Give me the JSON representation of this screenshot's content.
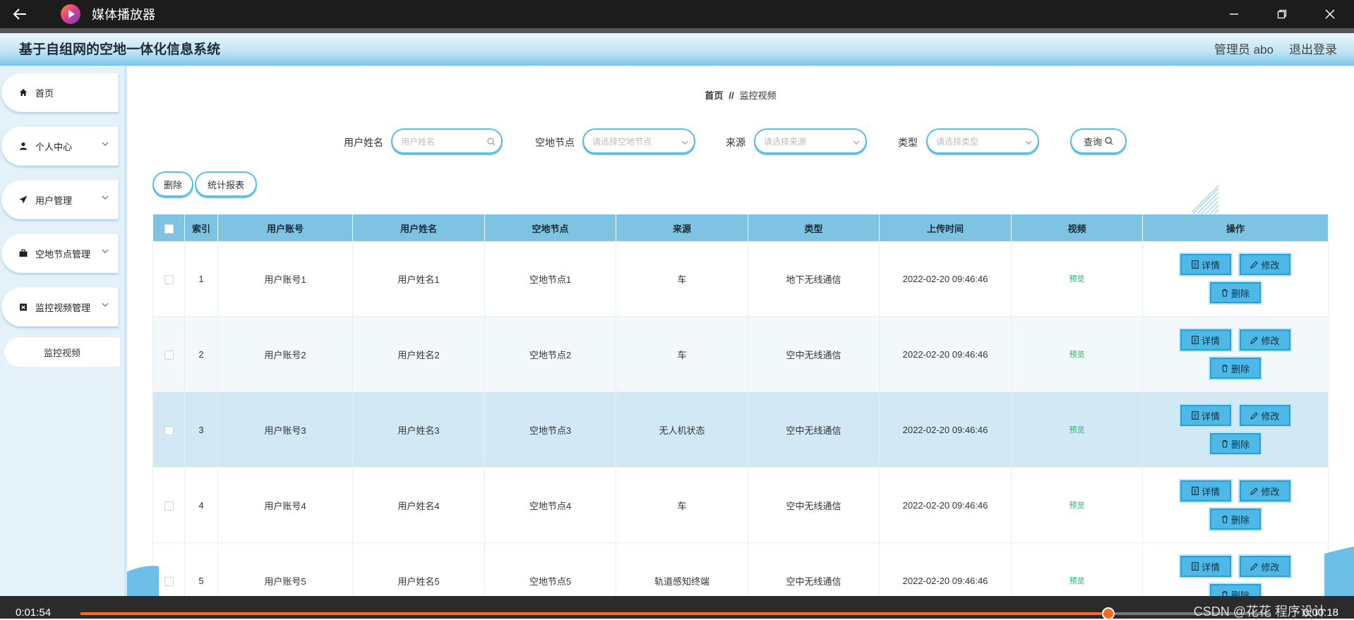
{
  "player": {
    "app_title": "媒体播放器",
    "time_elapsed": "0:01:54",
    "time_remaining": "0:00:18",
    "progress_fraction": 0.8635,
    "watermark": "CSDN @花花 程序设计"
  },
  "header": {
    "system_title": "基于自组网的空地一体化信息系统",
    "admin_label": "管理员 abo",
    "logout_label": "退出登录"
  },
  "sidebar": {
    "items": [
      {
        "label": "首页",
        "icon": "home-icon"
      },
      {
        "label": "个人中心",
        "icon": "user-icon"
      },
      {
        "label": "用户管理",
        "icon": "send-icon"
      },
      {
        "label": "空地节点管理",
        "icon": "briefcase-icon"
      },
      {
        "label": "监控视频管理",
        "icon": "clipboard-icon"
      }
    ],
    "sub_item": "监控视频"
  },
  "breadcrumb": {
    "home": "首页",
    "separator": "//",
    "current": "监控视频"
  },
  "search": {
    "username_label": "用户姓名",
    "username_placeholder": "用户姓名",
    "node_label": "空地节点",
    "node_placeholder": "请选择空地节点",
    "source_label": "来源",
    "source_placeholder": "请选择来源",
    "type_label": "类型",
    "type_placeholder": "请选择类型",
    "query_label": "查询"
  },
  "actions": {
    "delete_label": "删除",
    "report_label": "统计报表"
  },
  "table": {
    "columns": [
      "索引",
      "用户账号",
      "用户姓名",
      "空地节点",
      "来源",
      "类型",
      "上传时间",
      "视频",
      "操作"
    ],
    "detail_label": "详情",
    "edit_label": "修改",
    "delete_label": "删除",
    "preview_label": "预览",
    "rows": [
      {
        "index": "1",
        "account": "用户账号1",
        "name": "用户姓名1",
        "node": "空地节点1",
        "source": "车",
        "type": "地下无线通信",
        "time": "2022-02-20 09:46:46"
      },
      {
        "index": "2",
        "account": "用户账号2",
        "name": "用户姓名2",
        "node": "空地节点2",
        "source": "车",
        "type": "空中无线通信",
        "time": "2022-02-20 09:46:46"
      },
      {
        "index": "3",
        "account": "用户账号3",
        "name": "用户姓名3",
        "node": "空地节点3",
        "source": "无人机状态",
        "type": "空中无线通信",
        "time": "2022-02-20 09:46:46"
      },
      {
        "index": "4",
        "account": "用户账号4",
        "name": "用户姓名4",
        "node": "空地节点4",
        "source": "车",
        "type": "空中无线通信",
        "time": "2022-02-20 09:46:46"
      },
      {
        "index": "5",
        "account": "用户账号5",
        "name": "用户姓名5",
        "node": "空地节点5",
        "source": "轨道感知终端",
        "type": "空中无线通信",
        "time": "2022-02-20 09:46:46"
      }
    ]
  },
  "colors": {
    "header_blue": "#7ec4e2",
    "button_blue": "#4eb9e6",
    "preview_green": "#2ab06b",
    "progress_orange": "#ff6a1f"
  }
}
